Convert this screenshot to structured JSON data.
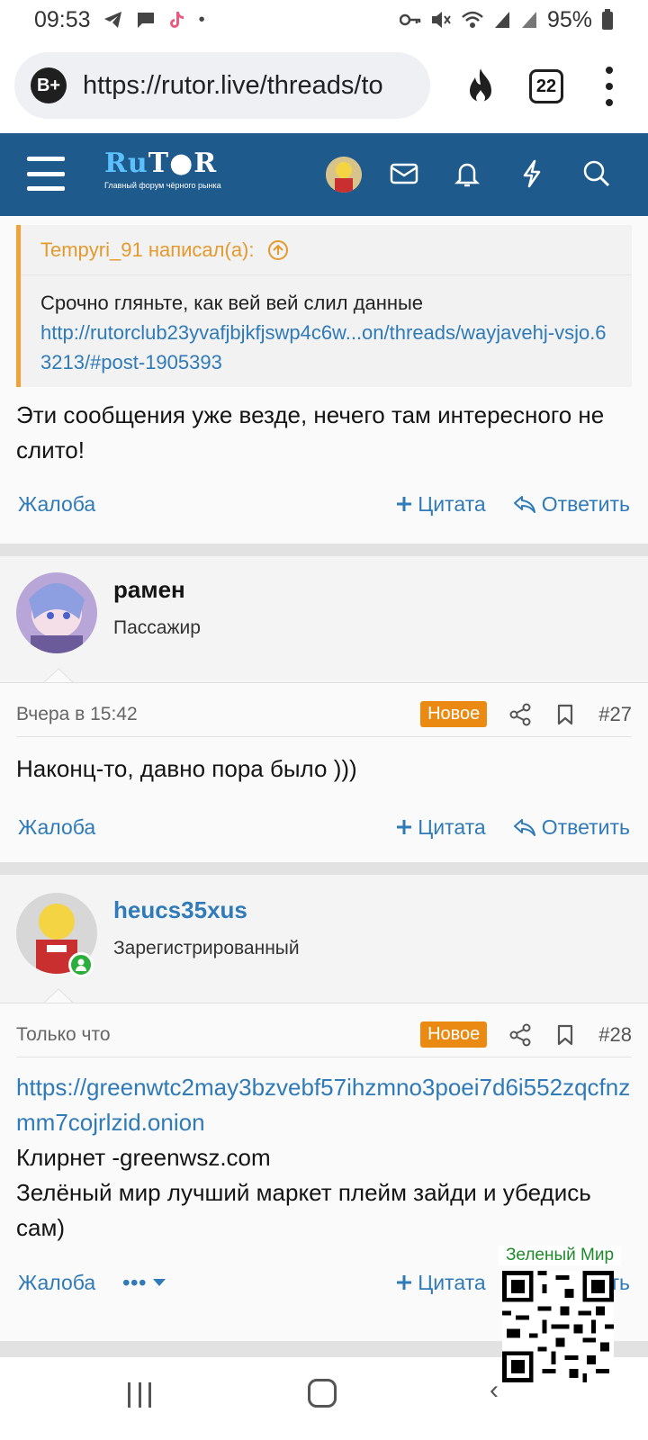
{
  "status_bar": {
    "time": "09:53",
    "battery": "95%",
    "left_icons": [
      "telegram-icon",
      "message-icon",
      "tiktok-icon",
      "dot-icon"
    ],
    "right_icons": [
      "key-icon",
      "mute-icon",
      "wifi-icon",
      "signal-icon",
      "signal-icon",
      "battery-icon"
    ]
  },
  "browser": {
    "badge": "B+",
    "url": "https://rutor.live/threads/to",
    "tabs_count": "22"
  },
  "forum_header": {
    "logo_ru": "Ru",
    "logo_rest": "T●R",
    "tagline": "Главный форум чёрного рынка"
  },
  "post1": {
    "quote_author": "Tempyri_91 написал(а):",
    "quote_line1": "Срочно гляньте, как вей вей слил данные",
    "quote_link": "http://rutorclub23yvafjbjkfjswp4c6w...on/threads/wayjavehj-vsjo.63213/#post-1905393",
    "text": "Эти сообщения уже везде, нечего там интересного не слито!",
    "actions": {
      "report": "Жалоба",
      "quote": "Цитата",
      "reply": "Ответить"
    }
  },
  "post2": {
    "username": "рамен",
    "usertitle": "Пассажир",
    "date": "Вчера в 15:42",
    "badge": "Новое",
    "number": "#27",
    "text": "Наконц-то, давно пора было )))",
    "actions": {
      "report": "Жалоба",
      "quote": "Цитата",
      "reply": "Ответить"
    }
  },
  "post3": {
    "username": "heucs35xus",
    "usertitle": "Зарегистрированный",
    "date": "Только что",
    "badge": "Новое",
    "number": "#28",
    "link": "https://greenwtc2may3bzvebf57ihzmno3poei7d6i552zqcfnzmm7cojrlzid.onion",
    "line2": "Клирнет -greenwsz.com",
    "line3": "Зелёный мир лучший маркет плейм зайди и убедись сам)",
    "actions": {
      "report": "Жалоба",
      "more": "•••",
      "quote": "Цитата",
      "reply": "Ответить"
    }
  },
  "ad": {
    "title": "Зеленый Мир"
  },
  "colors": {
    "header": "#1f5a8c",
    "link": "#2f7ab8",
    "quote_accent": "#f1a33a",
    "badge": "#ea8a12",
    "online": "#2cae3c"
  }
}
